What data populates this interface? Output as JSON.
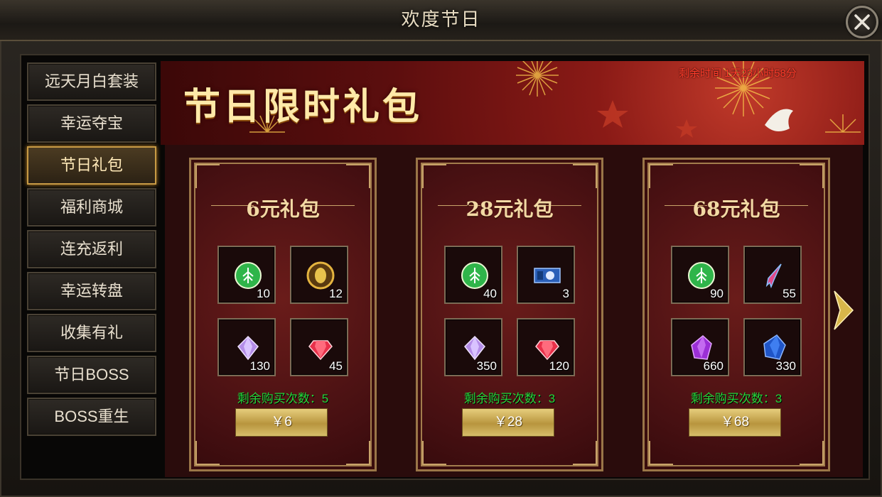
{
  "window": {
    "title": "欢度节日"
  },
  "sidebar": {
    "items": [
      {
        "label": "远天月白套装"
      },
      {
        "label": "幸运夺宝"
      },
      {
        "label": "节日礼包"
      },
      {
        "label": "福利商城"
      },
      {
        "label": "连充返利"
      },
      {
        "label": "幸运转盘"
      },
      {
        "label": "收集有礼"
      },
      {
        "label": "节日BOSS"
      },
      {
        "label": "BOSS重生"
      }
    ],
    "active_index": 2
  },
  "banner": {
    "title": "节日限时礼包",
    "timer": "剩余时间 1天23小时58分"
  },
  "packages": [
    {
      "title": "6元礼包",
      "items": [
        {
          "icon": "green-tree-orb-icon",
          "qty": "10"
        },
        {
          "icon": "gold-leaf-orb-icon",
          "qty": "12"
        },
        {
          "icon": "purple-diamond-icon",
          "qty": "130"
        },
        {
          "icon": "red-ruby-icon",
          "qty": "45"
        }
      ],
      "remaining": "剩余购买次数：5",
      "price": "￥6"
    },
    {
      "title": "28元礼包",
      "items": [
        {
          "icon": "green-tree-orb-icon",
          "qty": "40"
        },
        {
          "icon": "blue-scroll-icon",
          "qty": "3"
        },
        {
          "icon": "purple-diamond-icon",
          "qty": "350"
        },
        {
          "icon": "red-ruby-icon",
          "qty": "120"
        }
      ],
      "remaining": "剩余购买次数：3",
      "price": "￥28"
    },
    {
      "title": "68元礼包",
      "items": [
        {
          "icon": "green-tree-orb-icon",
          "qty": "90"
        },
        {
          "icon": "feather-shard-icon",
          "qty": "55"
        },
        {
          "icon": "purple-crystal-icon",
          "qty": "660"
        },
        {
          "icon": "blue-crystal-icon",
          "qty": "330"
        }
      ],
      "remaining": "剩余购买次数：3",
      "price": "￥68"
    }
  ],
  "colors": {
    "accent_gold": "#c9a46a",
    "timer_red": "#ff3b2a",
    "remaining_green": "#26d63a",
    "panel_red": "#471012"
  }
}
